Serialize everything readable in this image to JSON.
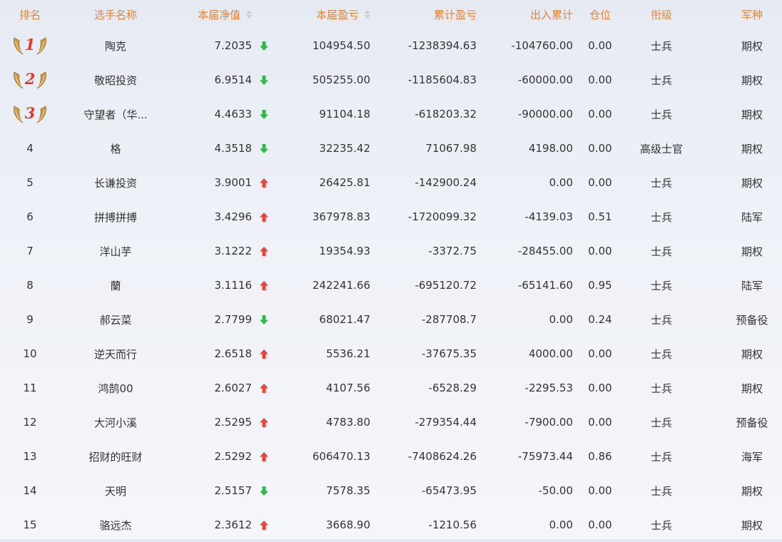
{
  "headers": {
    "rank": "排名",
    "name": "选手名称",
    "nav": "本届净值",
    "pnl": "本届盈亏",
    "cum": "累计盈亏",
    "flow": "出入累计",
    "pos": "仓位",
    "rank_title": "衔级",
    "arm": "军种"
  },
  "colors": {
    "header": "#e2863c",
    "up": "#e8443a",
    "down": "#2fb84a",
    "badge": "#e23a2c"
  },
  "rows": [
    {
      "rank": "1",
      "medal": true,
      "name": "陶克",
      "nav": "7.2035",
      "trend": "down",
      "pnl": "104954.50",
      "cum": "-1238394.63",
      "flow": "-104760.00",
      "pos": "0.00",
      "title": "士兵",
      "arm": "期权"
    },
    {
      "rank": "2",
      "medal": true,
      "name": "敬昭投资",
      "nav": "6.9514",
      "trend": "down",
      "pnl": "505255.00",
      "cum": "-1185604.83",
      "flow": "-60000.00",
      "pos": "0.00",
      "title": "士兵",
      "arm": "期权"
    },
    {
      "rank": "3",
      "medal": true,
      "name": "守望者（华...",
      "nav": "4.4633",
      "trend": "down",
      "pnl": "91104.18",
      "cum": "-618203.32",
      "flow": "-90000.00",
      "pos": "0.00",
      "title": "士兵",
      "arm": "期权"
    },
    {
      "rank": "4",
      "medal": false,
      "name": "格",
      "nav": "4.3518",
      "trend": "down",
      "pnl": "32235.42",
      "cum": "71067.98",
      "flow": "4198.00",
      "pos": "0.00",
      "title": "高级士官",
      "arm": "期权"
    },
    {
      "rank": "5",
      "medal": false,
      "name": "长谦投资",
      "nav": "3.9001",
      "trend": "up",
      "pnl": "26425.81",
      "cum": "-142900.24",
      "flow": "0.00",
      "pos": "0.00",
      "title": "士兵",
      "arm": "期权"
    },
    {
      "rank": "6",
      "medal": false,
      "name": "拼搏拼搏",
      "nav": "3.4296",
      "trend": "up",
      "pnl": "367978.83",
      "cum": "-1720099.32",
      "flow": "-4139.03",
      "pos": "0.51",
      "title": "士兵",
      "arm": "陆军"
    },
    {
      "rank": "7",
      "medal": false,
      "name": "洋山芋",
      "nav": "3.1222",
      "trend": "up",
      "pnl": "19354.93",
      "cum": "-3372.75",
      "flow": "-28455.00",
      "pos": "0.00",
      "title": "士兵",
      "arm": "期权"
    },
    {
      "rank": "8",
      "medal": false,
      "name": "蘭",
      "nav": "3.1116",
      "trend": "up",
      "pnl": "242241.66",
      "cum": "-695120.72",
      "flow": "-65141.60",
      "pos": "0.95",
      "title": "士兵",
      "arm": "陆军"
    },
    {
      "rank": "9",
      "medal": false,
      "name": "郝云菜",
      "nav": "2.7799",
      "trend": "down",
      "pnl": "68021.47",
      "cum": "-287708.7",
      "flow": "0.00",
      "pos": "0.24",
      "title": "士兵",
      "arm": "预备役"
    },
    {
      "rank": "10",
      "medal": false,
      "name": "逆天而行",
      "nav": "2.6518",
      "trend": "up",
      "pnl": "5536.21",
      "cum": "-37675.35",
      "flow": "4000.00",
      "pos": "0.00",
      "title": "士兵",
      "arm": "期权"
    },
    {
      "rank": "11",
      "medal": false,
      "name": "鸿鹄00",
      "nav": "2.6027",
      "trend": "up",
      "pnl": "4107.56",
      "cum": "-6528.29",
      "flow": "-2295.53",
      "pos": "0.00",
      "title": "士兵",
      "arm": "期权"
    },
    {
      "rank": "12",
      "medal": false,
      "name": "大河小溪",
      "nav": "2.5295",
      "trend": "up",
      "pnl": "4783.80",
      "cum": "-279354.44",
      "flow": "-7900.00",
      "pos": "0.00",
      "title": "士兵",
      "arm": "预备役"
    },
    {
      "rank": "13",
      "medal": false,
      "name": "招财的旺财",
      "nav": "2.5292",
      "trend": "up",
      "pnl": "606470.13",
      "cum": "-7408624.26",
      "flow": "-75973.44",
      "pos": "0.86",
      "title": "士兵",
      "arm": "海军"
    },
    {
      "rank": "14",
      "medal": false,
      "name": "天明",
      "nav": "2.5157",
      "trend": "down",
      "pnl": "7578.35",
      "cum": "-65473.95",
      "flow": "-50.00",
      "pos": "0.00",
      "title": "士兵",
      "arm": "期权"
    },
    {
      "rank": "15",
      "medal": false,
      "name": "骆远杰",
      "nav": "2.3612",
      "trend": "up",
      "pnl": "3668.90",
      "cum": "-1210.56",
      "flow": "0.00",
      "pos": "0.00",
      "title": "士兵",
      "arm": "期权"
    }
  ]
}
